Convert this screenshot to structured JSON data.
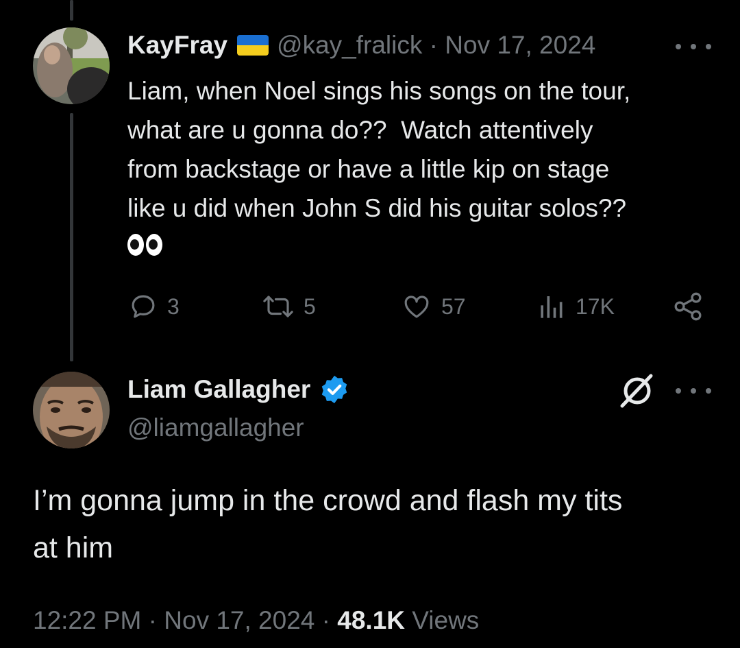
{
  "parent_tweet": {
    "display_name": "KayFray",
    "flag_icon": "ukraine-flag-icon",
    "handle": "@kay_fralick",
    "separator": " · ",
    "date": "Nov 17, 2024",
    "text_lines": [
      "Liam, when Noel sings his songs on the tour,",
      "what are u gonna do??  Watch attentively",
      "from backstage or have a little kip on stage",
      "like u did when John S did his guitar solos??"
    ],
    "emoji": "eyes-emoji",
    "metrics": {
      "replies": "3",
      "reposts": "5",
      "likes": "57",
      "views": "17K"
    }
  },
  "main_tweet": {
    "display_name": "Liam Gallagher",
    "verified": true,
    "handle": "@liamgallagher",
    "text_lines": [
      "I’m gonna jump in the crowd and flash my tits",
      "at him"
    ],
    "time": "12:22 PM",
    "separator": " · ",
    "date": "Nov 17, 2024",
    "views_count": "48.1K",
    "views_label": "Views"
  },
  "colors": {
    "background": "#000000",
    "text": "#e7e9ea",
    "muted": "#71767b",
    "verified": "#1d9bf0",
    "thread_line": "#333639"
  }
}
